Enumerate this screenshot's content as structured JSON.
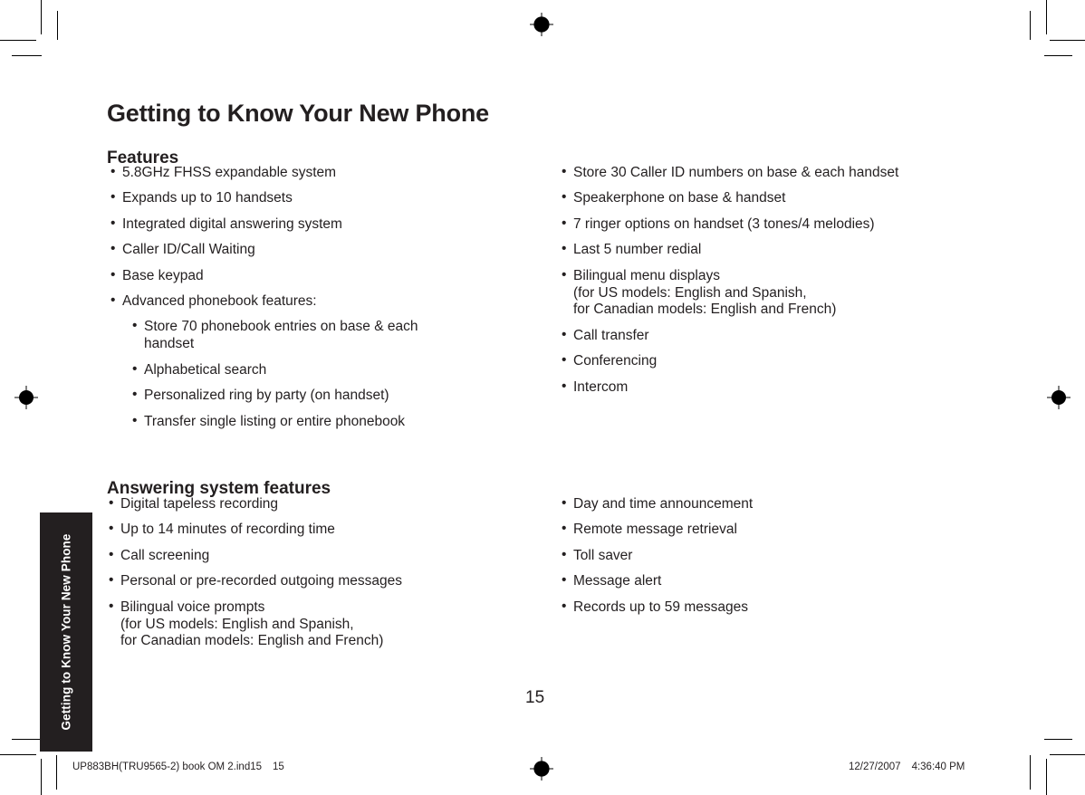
{
  "document": {
    "title": "Getting to Know Your New Phone",
    "page_number": "15",
    "side_tab_label": "Getting to Know Your New Phone"
  },
  "sections": [
    {
      "heading": "Features",
      "left_column": [
        {
          "lines": [
            "5.8GHz FHSS expandable system"
          ]
        },
        {
          "lines": [
            "Expands up to 10 handsets"
          ]
        },
        {
          "lines": [
            "Integrated digital answering system"
          ]
        },
        {
          "lines": [
            "Caller ID/Call Waiting"
          ]
        },
        {
          "lines": [
            "Base keypad"
          ]
        },
        {
          "lines": [
            "Advanced phonebook features:"
          ],
          "sub": [
            {
              "lines": [
                "Store 70 phonebook entries on base & each",
                "handset"
              ]
            },
            {
              "lines": [
                "Alphabetical search"
              ]
            },
            {
              "lines": [
                "Personalized ring by party (on handset)"
              ]
            },
            {
              "lines": [
                "Transfer single listing or entire phonebook"
              ]
            }
          ]
        }
      ],
      "right_column": [
        {
          "lines": [
            "Store 30 Caller ID numbers on base & each handset"
          ]
        },
        {
          "lines": [
            "Speakerphone on base & handset"
          ]
        },
        {
          "lines": [
            "7 ringer options on handset (3 tones/4 melodies)"
          ]
        },
        {
          "lines": [
            "Last 5 number redial"
          ]
        },
        {
          "lines": [
            "Bilingual menu displays",
            "(for US models: English and Spanish,",
            "for Canadian models: English and French)"
          ]
        },
        {
          "lines": [
            "Call transfer"
          ]
        },
        {
          "lines": [
            "Conferencing"
          ]
        },
        {
          "lines": [
            "Intercom"
          ]
        }
      ]
    },
    {
      "heading": "Answering system features",
      "left_column": [
        {
          "lines": [
            "Digital tapeless recording"
          ]
        },
        {
          "lines": [
            "Up to 14 minutes of recording time"
          ]
        },
        {
          "lines": [
            "Call screening"
          ]
        },
        {
          "lines": [
            "Personal or pre-recorded outgoing messages"
          ]
        },
        {
          "lines": [
            "Bilingual voice prompts",
            "(for US models: English and Spanish,",
            "for Canadian models: English and French)"
          ]
        }
      ],
      "right_column": [
        {
          "lines": [
            "Day and time announcement"
          ]
        },
        {
          "lines": [
            "Remote message retrieval"
          ]
        },
        {
          "lines": [
            "Toll saver"
          ]
        },
        {
          "lines": [
            "Message alert"
          ]
        },
        {
          "lines": [
            "Records up to 59 messages"
          ]
        }
      ]
    }
  ],
  "footer": {
    "file_name": "UP883BH(TRU9565-2) book OM 2.ind15",
    "sheet_index": "15",
    "date": "12/27/2007",
    "time": "4:36:40 PM"
  },
  "colors": {
    "ink": "#231f20",
    "tab_background": "#231f20",
    "tab_text": "#ffffff",
    "paper": "#ffffff"
  }
}
